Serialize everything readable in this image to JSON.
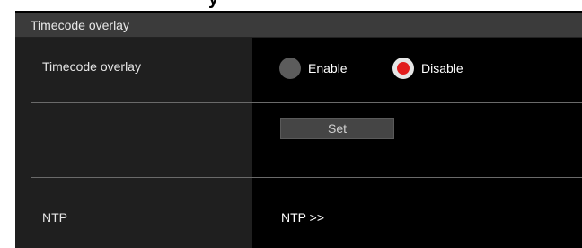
{
  "header": {
    "title_fragment": "y",
    "section_title": "Timecode overlay"
  },
  "timecode_overlay": {
    "label": "Timecode overlay",
    "options": [
      {
        "label": "Enable",
        "selected": false
      },
      {
        "label": "Disable",
        "selected": true
      }
    ],
    "selected": "Disable"
  },
  "set_button": {
    "label": "Set"
  },
  "ntp": {
    "label": "NTP",
    "link": "NTP >>"
  },
  "colors": {
    "panel_bg": "#000000",
    "label_col_bg": "#1f1f1f",
    "header_bg": "#3b3b3b",
    "radio_selected": "#e21e1e",
    "radio_unselected": "#5c5c5c"
  },
  "icons": {
    "radio_enable": "radio-unchecked-icon",
    "radio_disable": "radio-checked-icon"
  }
}
